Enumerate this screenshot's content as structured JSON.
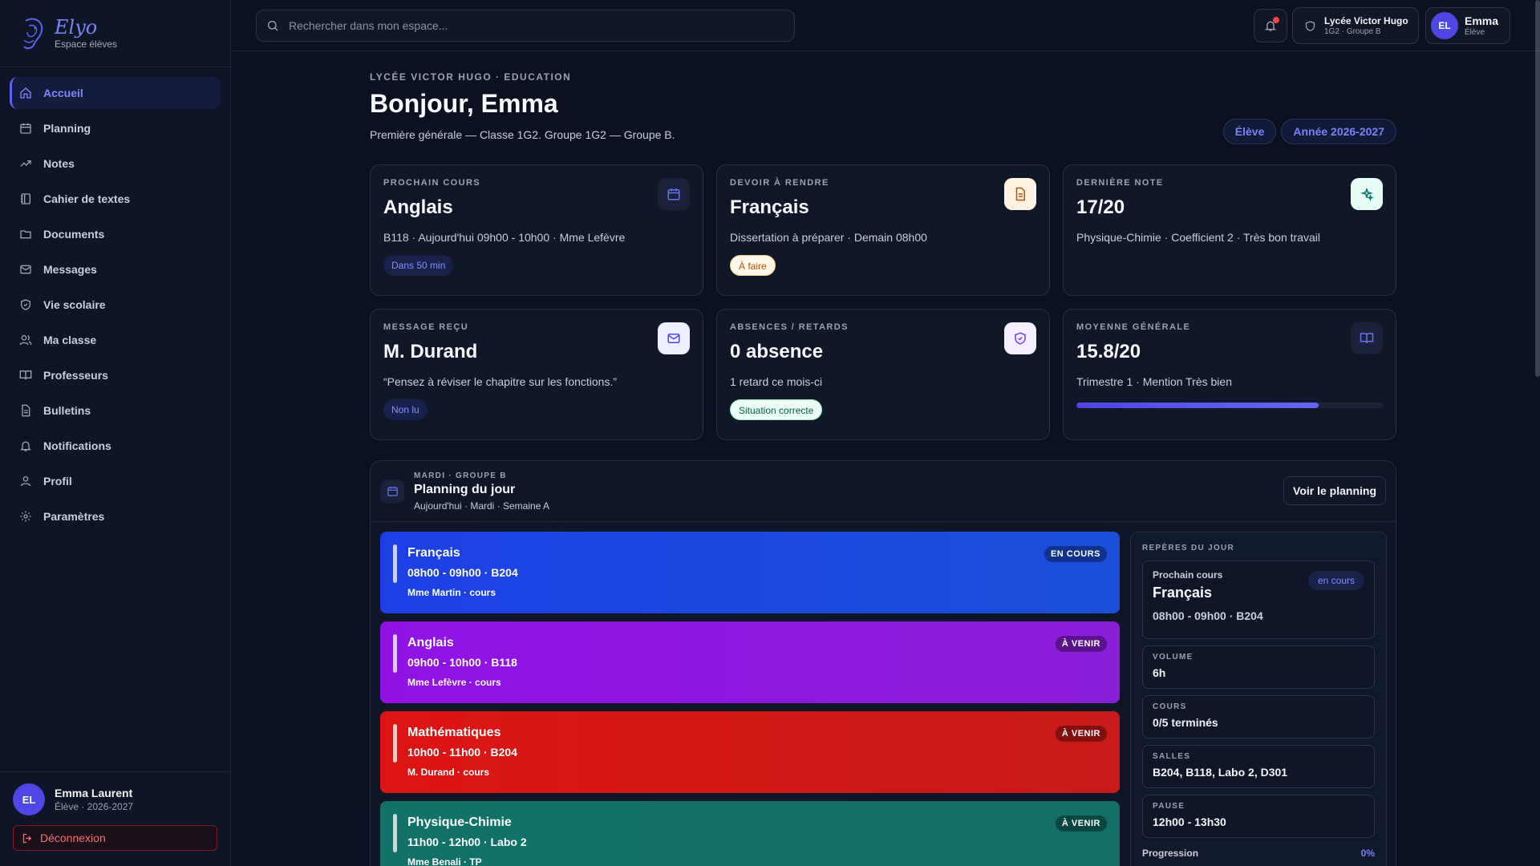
{
  "brand": {
    "name": "Elyo",
    "subtitle": "Espace élèves"
  },
  "sidebar": {
    "items": [
      {
        "label": "Accueil",
        "icon": "home-icon"
      },
      {
        "label": "Planning",
        "icon": "calendar-icon"
      },
      {
        "label": "Notes",
        "icon": "trending-icon"
      },
      {
        "label": "Cahier de textes",
        "icon": "notebook-icon"
      },
      {
        "label": "Documents",
        "icon": "folder-icon"
      },
      {
        "label": "Messages",
        "icon": "mail-icon"
      },
      {
        "label": "Vie scolaire",
        "icon": "shield-icon"
      },
      {
        "label": "Ma classe",
        "icon": "users-icon"
      },
      {
        "label": "Professeurs",
        "icon": "book-icon"
      },
      {
        "label": "Bulletins",
        "icon": "file-icon"
      },
      {
        "label": "Notifications",
        "icon": "bell-icon"
      },
      {
        "label": "Profil",
        "icon": "user-icon"
      },
      {
        "label": "Paramètres",
        "icon": "gear-icon"
      }
    ],
    "active_index": 0,
    "footer": {
      "initials": "EL",
      "name": "Emma Laurent",
      "sub": "Élève · 2026-2027",
      "logout": "Déconnexion"
    }
  },
  "topbar": {
    "search_placeholder": "Rechercher dans mon espace...",
    "school": {
      "title": "Lycée Victor Hugo",
      "sub": "1G2 · Groupe B"
    },
    "user": {
      "initials": "EL",
      "name": "Emma",
      "role": "Élève"
    }
  },
  "header": {
    "eyebrow": "LYCÉE VICTOR HUGO · EDUCATION",
    "greeting": "Bonjour, Emma",
    "subtitle": "Première générale — Classe 1G2. Groupe 1G2 — Groupe B.",
    "pills": [
      "Élève",
      "Année 2026-2027"
    ]
  },
  "cards": [
    {
      "label": "PROCHAIN COURS",
      "value": "Anglais",
      "desc": "B118 · Aujourd'hui 09h00 - 10h00 · Mme Lefèvre",
      "tag": "Dans 50 min",
      "icon": "calendar-icon"
    },
    {
      "label": "DEVOIR À RENDRE",
      "value": "Français",
      "desc": "Dissertation à préparer · Demain 08h00",
      "tag": "À faire",
      "icon": "document-icon"
    },
    {
      "label": "DERNIÈRE NOTE",
      "value": "17/20",
      "desc": "Physique-Chimie · Coefficient 2 · Très bon travail",
      "tag": "",
      "icon": "sparkles-icon"
    },
    {
      "label": "MESSAGE REÇU",
      "value": "M. Durand",
      "desc": "“Pensez à réviser le chapitre sur les fonctions.”",
      "tag": "Non lu",
      "icon": "mail-icon"
    },
    {
      "label": "ABSENCES / RETARDS",
      "value": "0 absence",
      "desc": "1 retard ce mois-ci",
      "tag": "Situation correcte",
      "icon": "shield-check-icon"
    },
    {
      "label": "MOYENNE GÉNÉRALE",
      "value": "15.8/20",
      "desc": "Trimestre 1 · Mention Très bien",
      "tag": "",
      "icon": "book-open-icon",
      "progress": 0.79
    }
  ],
  "planning": {
    "eyebrow": "MARDI · GROUPE B",
    "title": "Planning du jour",
    "sub": "Aujourd'hui · Mardi · Semaine A",
    "button": "Voir le planning",
    "courses": [
      {
        "name": "Français",
        "time": "08h00 - 09h00 · B204",
        "teacher": "Mme Martin · cours",
        "badge": "EN COURS",
        "color": "#1d3fe6"
      },
      {
        "name": "Anglais",
        "time": "09h00 - 10h00 · B118",
        "teacher": "Mme Lefèvre · cours",
        "badge": "À VENIR",
        "color": "#9111e5"
      },
      {
        "name": "Mathématiques",
        "time": "10h00 - 11h00 · B204",
        "teacher": "M. Durand · cours",
        "badge": "À VENIR",
        "color": "#dc1414"
      },
      {
        "name": "Physique-Chimie",
        "time": "11h00 - 12h00 · Labo 2",
        "teacher": "Mme Benali · TP",
        "badge": "À VENIR",
        "color": "#12726a"
      }
    ],
    "reperes": {
      "title": "REPÈRES DU JOUR",
      "next_label": "Prochain cours",
      "next_pill": "en cours",
      "next_course": "Français",
      "next_time": "08h00 - 09h00 · B204",
      "stats": [
        {
          "k": "VOLUME",
          "v": "6h"
        },
        {
          "k": "COURS",
          "v": "0/5 terminés"
        },
        {
          "k": "SALLES",
          "v": "B204, B118, Labo 2, D301"
        },
        {
          "k": "PAUSE",
          "v": "12h00 - 13h30"
        }
      ],
      "progress_label": "Progression",
      "progress_value": "0%"
    }
  }
}
